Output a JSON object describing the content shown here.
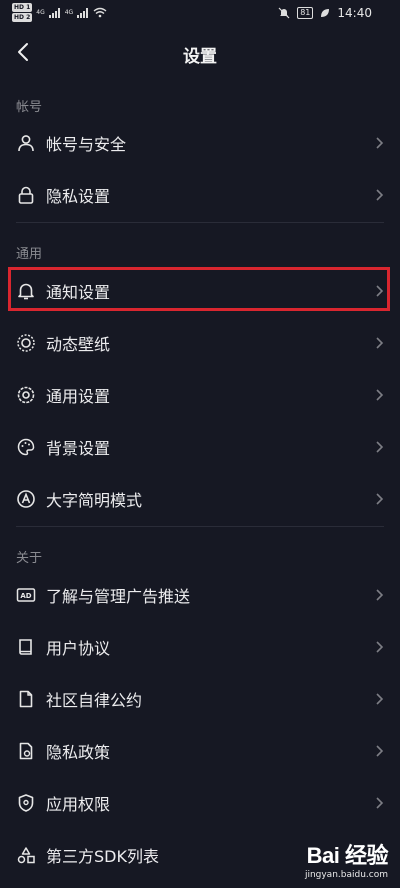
{
  "status_bar": {
    "hd1": "HD 1",
    "hd2": "HD 2",
    "signal1": "4G",
    "signal2": "4G",
    "battery": "81",
    "time": "14:40"
  },
  "header": {
    "title": "设置"
  },
  "sections": {
    "account": {
      "label": "帐号",
      "items": [
        {
          "label": "帐号与安全",
          "icon": "person-icon"
        },
        {
          "label": "隐私设置",
          "icon": "lock-icon"
        }
      ]
    },
    "general": {
      "label": "通用",
      "items": [
        {
          "label": "通知设置",
          "icon": "bell-icon",
          "highlighted": true
        },
        {
          "label": "动态壁纸",
          "icon": "live-wallpaper-icon"
        },
        {
          "label": "通用设置",
          "icon": "gear-icon"
        },
        {
          "label": "背景设置",
          "icon": "palette-icon"
        },
        {
          "label": "大字简明模式",
          "icon": "large-font-icon"
        }
      ]
    },
    "about": {
      "label": "关于",
      "items": [
        {
          "label": "了解与管理广告推送",
          "icon": "ad-icon"
        },
        {
          "label": "用户协议",
          "icon": "book-icon"
        },
        {
          "label": "社区自律公约",
          "icon": "document-icon"
        },
        {
          "label": "隐私政策",
          "icon": "privacy-document-icon"
        },
        {
          "label": "应用权限",
          "icon": "shield-icon"
        },
        {
          "label": "第三方SDK列表",
          "icon": "cluster-icon"
        }
      ]
    }
  },
  "watermark": {
    "brand": "Bai 经验",
    "url": "jingyan.baidu.com"
  },
  "colors": {
    "background": "#161823",
    "highlight_border": "#d9262f",
    "muted_text": "#8a8b91"
  }
}
